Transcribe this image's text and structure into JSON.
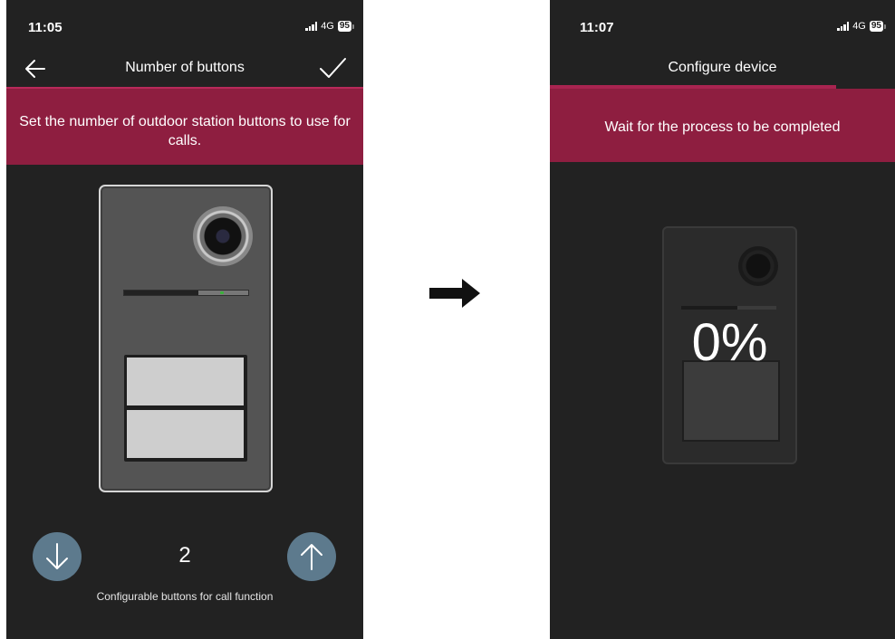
{
  "left_screen": {
    "status": {
      "time": "11:05",
      "network": "4G",
      "battery": "95"
    },
    "nav": {
      "title": "Number of buttons"
    },
    "banner": {
      "text": "Set the number of outdoor station buttons to use for calls."
    },
    "counter": {
      "value": "2",
      "caption": "Configurable buttons for call function"
    }
  },
  "right_screen": {
    "status": {
      "time": "11:07",
      "network": "4G",
      "battery": "95"
    },
    "nav": {
      "title": "Configure device"
    },
    "banner": {
      "text": "Wait for the process to be completed"
    },
    "progress": {
      "percent_text": "0%"
    }
  },
  "colors": {
    "background": "#222222",
    "accent": "#8e1e40",
    "round_button": "#5d7a8d"
  },
  "icons": [
    "back-arrow-icon",
    "checkmark-icon",
    "arrow-down-icon",
    "arrow-up-icon",
    "right-arrow-icon",
    "signal-icon",
    "battery-icon"
  ]
}
